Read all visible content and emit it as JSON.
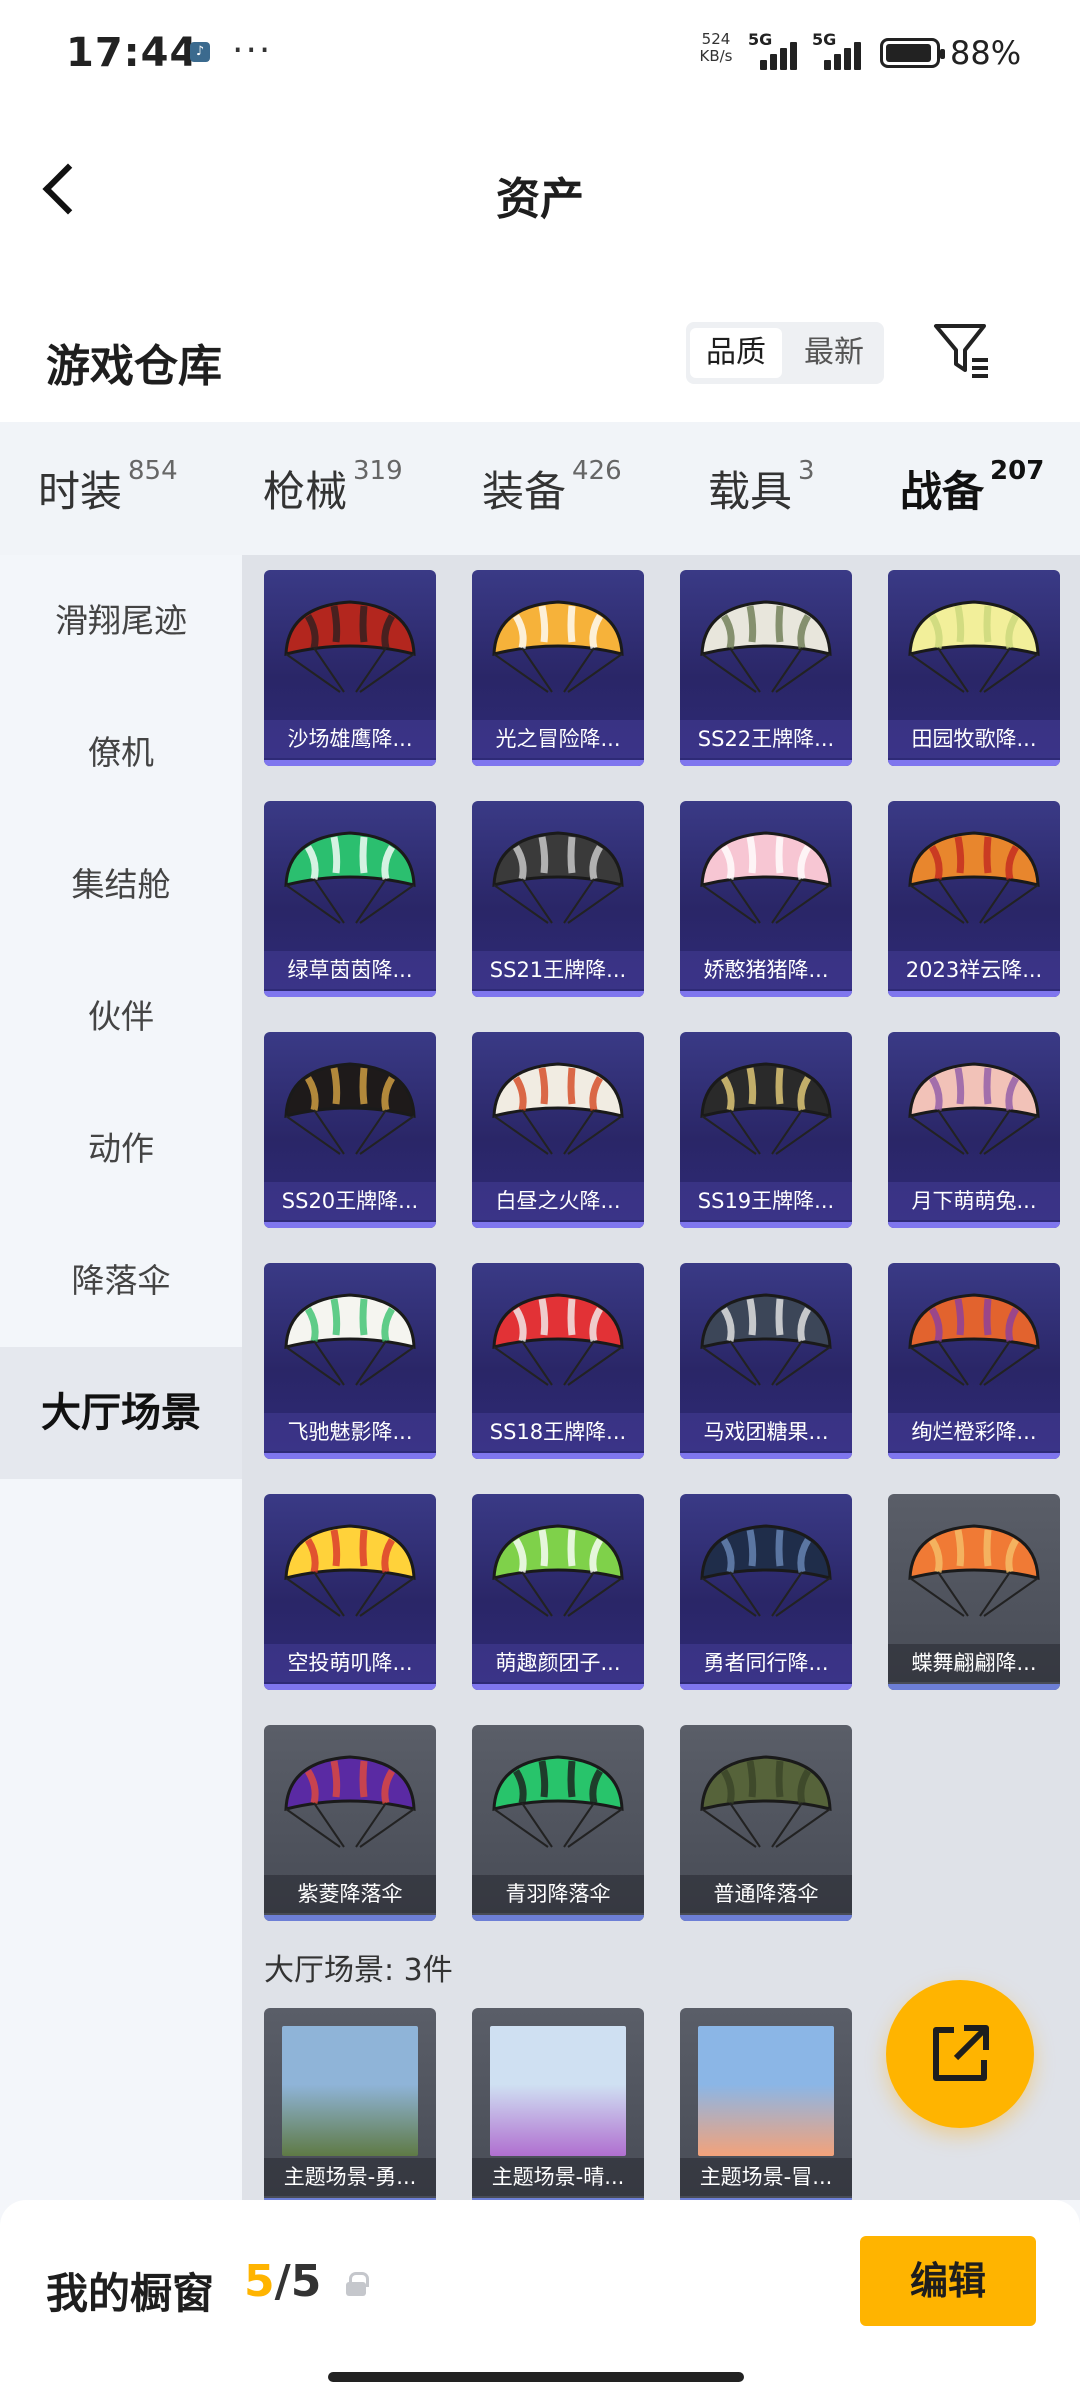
{
  "status_bar": {
    "time": "17:44",
    "speed": "524\nKB/s",
    "net1": "5G",
    "net2": "5G",
    "battery": "88%"
  },
  "header": {
    "title": "资产"
  },
  "warehouse": {
    "title": "游戏仓库",
    "sort_quality": "品质",
    "sort_newest": "最新"
  },
  "categories": [
    {
      "label": "时装",
      "count": "854"
    },
    {
      "label": "枪械",
      "count": "319"
    },
    {
      "label": "装备",
      "count": "426"
    },
    {
      "label": "载具",
      "count": "3"
    },
    {
      "label": "战备",
      "count": "207",
      "active": true
    }
  ],
  "sidebar": [
    "滑翔尾迹",
    "僚机",
    "集结舱",
    "伙伴",
    "动作",
    "降落伞",
    "大厅场景"
  ],
  "sidebar_active": "大厅场景",
  "parachutes": [
    {
      "name": "沙场雄鹰降...",
      "colors": [
        "#b3261e",
        "#2d1f1f"
      ]
    },
    {
      "name": "光之冒险降...",
      "colors": [
        "#f6b23a",
        "#ffffff"
      ]
    },
    {
      "name": "SS22王牌降...",
      "colors": [
        "#e8e6dc",
        "#6b7b52"
      ]
    },
    {
      "name": "田园牧歌降...",
      "colors": [
        "#f2ef9a",
        "#c9d77a"
      ]
    },
    {
      "name": "绿草茵茵降...",
      "colors": [
        "#2bbf6f",
        "#ffffff"
      ]
    },
    {
      "name": "SS21王牌降...",
      "colors": [
        "#3a3a3a",
        "#cfcfcf"
      ]
    },
    {
      "name": "娇憨猪猪降...",
      "colors": [
        "#f7c6d3",
        "#ffffff"
      ]
    },
    {
      "name": "2023祥云降...",
      "colors": [
        "#e8862d",
        "#c2281f"
      ]
    },
    {
      "name": "SS20王牌降...",
      "colors": [
        "#1e1a1a",
        "#d7a443"
      ]
    },
    {
      "name": "白昼之火降...",
      "colors": [
        "#f1ece2",
        "#d44720"
      ]
    },
    {
      "name": "SS19王牌降...",
      "colors": [
        "#2a2a2a",
        "#e8d07a"
      ]
    },
    {
      "name": "月下萌萌兔...",
      "colors": [
        "#f2c2b8",
        "#8e5aa8"
      ]
    },
    {
      "name": "飞驰魅影降...",
      "colors": [
        "#f5f5f0",
        "#3ac26e"
      ]
    },
    {
      "name": "SS18王牌降...",
      "colors": [
        "#e23236",
        "#f2f2f2"
      ]
    },
    {
      "name": "马戏团糖果...",
      "colors": [
        "#3c4658",
        "#e8e8e8"
      ]
    },
    {
      "name": "绚烂橙彩降...",
      "colors": [
        "#e2632e",
        "#8a3fa0"
      ]
    },
    {
      "name": "空投萌叽降...",
      "colors": [
        "#ffd23a",
        "#d9332d"
      ]
    },
    {
      "name": "萌趣颜团子...",
      "colors": [
        "#7fd14a",
        "#ffffff"
      ]
    },
    {
      "name": "勇者同行降...",
      "colors": [
        "#1f2d4a",
        "#6a88b8"
      ]
    },
    {
      "name": "蝶舞翩翩降...",
      "colors": [
        "#f07a35",
        "#f5c16a"
      ],
      "grey": true
    },
    {
      "name": "紫菱降落伞",
      "colors": [
        "#5a2aa3",
        "#e44a3a"
      ],
      "grey": true
    },
    {
      "name": "青羽降落伞",
      "colors": [
        "#28c46b",
        "#1b1b1b"
      ],
      "grey": true
    },
    {
      "name": "普通降落伞",
      "colors": [
        "#56633a",
        "#3a4428"
      ],
      "grey": true
    }
  ],
  "scene_section": "大厅场景: 3件",
  "scenes": [
    {
      "name": "主题场景-勇...",
      "colors": [
        "#8fb4d8",
        "#5f7a45"
      ]
    },
    {
      "name": "主题场景-晴...",
      "colors": [
        "#cfe0f2",
        "#b06fd0"
      ]
    },
    {
      "name": "主题场景-冒...",
      "colors": [
        "#8bb6e6",
        "#f3a27a"
      ]
    }
  ],
  "showcase": {
    "label": "我的橱窗",
    "count": "5",
    "total": "/5",
    "edit": "编辑"
  },
  "icons": {
    "back": "back-arrow-icon",
    "filter": "filter-icon",
    "share": "external-link-icon",
    "lock": "lock-icon"
  }
}
